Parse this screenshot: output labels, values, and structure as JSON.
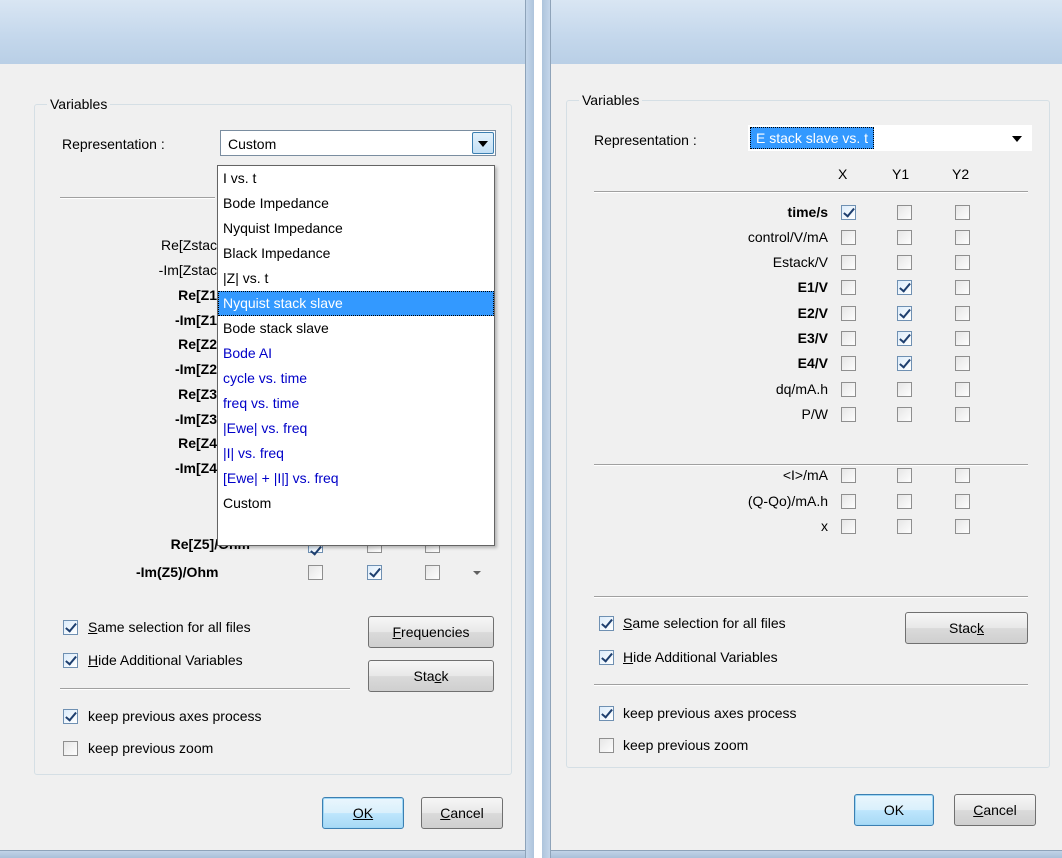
{
  "left_dialog": {
    "group_title": "Variables",
    "representation_label": "Representation :",
    "representation_value": "Custom",
    "dropdown_items": [
      {
        "label": "I vs. t",
        "style": "black"
      },
      {
        "label": "Bode Impedance",
        "style": "black"
      },
      {
        "label": "Nyquist Impedance",
        "style": "black"
      },
      {
        "label": "Black Impedance",
        "style": "black"
      },
      {
        "label": "|Z| vs. t",
        "style": "black"
      },
      {
        "label": "Nyquist stack slave",
        "style": "highlighted"
      },
      {
        "label": "Bode stack slave",
        "style": "black"
      },
      {
        "label": "Bode AI",
        "style": "blue"
      },
      {
        "label": "cycle vs. time",
        "style": "blue"
      },
      {
        "label": "freq vs. time",
        "style": "blue"
      },
      {
        "label": "|Ewe| vs. freq",
        "style": "blue"
      },
      {
        "label": "|I| vs. freq",
        "style": "blue"
      },
      {
        "label": "[Ewe| + |I|] vs. freq",
        "style": "blue"
      },
      {
        "label": "Custom",
        "style": "black"
      }
    ],
    "variables_visible": [
      {
        "text": "Re[Zstac",
        "bold": false
      },
      {
        "text": "-Im[Zstac",
        "bold": false
      },
      {
        "text": "Re[Z1",
        "bold": true
      },
      {
        "text": "-Im[Z1",
        "bold": true
      },
      {
        "text": "Re[Z2",
        "bold": true
      },
      {
        "text": "-Im[Z2",
        "bold": true
      },
      {
        "text": "Re[Z3",
        "bold": true
      },
      {
        "text": "-Im[Z3",
        "bold": true
      },
      {
        "text": "Re[Z4",
        "bold": true
      },
      {
        "text": "-Im[Z4",
        "bold": true
      },
      {
        "text": "Re[Z5]/Ohm",
        "bold": true
      }
    ],
    "last_row": {
      "label": "-Im(Z5)/Ohm",
      "x": false,
      "y1": true,
      "y2": false
    },
    "same_selection_label": "Same selection for all files",
    "same_selection_checked": true,
    "hide_additional_label": "Hide Additional Variables",
    "hide_additional_checked": true,
    "frequencies_label": "Frequencies",
    "stack_label": "Stack",
    "keep_axes_label": "keep previous axes process",
    "keep_axes_checked": true,
    "keep_zoom_label": "keep previous zoom",
    "keep_zoom_checked": false,
    "ok_label": "OK",
    "cancel_label": "Cancel"
  },
  "right_dialog": {
    "group_title": "Variables",
    "representation_label": "Representation :",
    "representation_value": "E stack slave vs. t",
    "col_x": "X",
    "col_y1": "Y1",
    "col_y2": "Y2",
    "rows": [
      {
        "label": "time/s",
        "bold": true,
        "x": true,
        "y1": false,
        "y2": false
      },
      {
        "label": "control/V/mA",
        "bold": false,
        "x": false,
        "y1": false,
        "y2": false
      },
      {
        "label": "Estack/V",
        "bold": false,
        "x": false,
        "y1": false,
        "y2": false
      },
      {
        "label": "E1/V",
        "bold": true,
        "x": false,
        "y1": true,
        "y2": false
      },
      {
        "label": "E2/V",
        "bold": true,
        "x": false,
        "y1": true,
        "y2": false
      },
      {
        "label": "E3/V",
        "bold": true,
        "x": false,
        "y1": true,
        "y2": false
      },
      {
        "label": "E4/V",
        "bold": true,
        "x": false,
        "y1": true,
        "y2": false
      },
      {
        "label": "dq/mA.h",
        "bold": false,
        "x": false,
        "y1": false,
        "y2": false
      },
      {
        "label": "P/W",
        "bold": false,
        "x": false,
        "y1": false,
        "y2": false
      },
      {
        "label": "<I>/mA",
        "bold": false,
        "x": false,
        "y1": false,
        "y2": false
      },
      {
        "label": "(Q-Qo)/mA.h",
        "bold": false,
        "x": false,
        "y1": false,
        "y2": false
      },
      {
        "label": "x",
        "bold": false,
        "x": false,
        "y1": false,
        "y2": false
      }
    ],
    "same_selection_label": "Same selection for all files",
    "same_selection_checked": true,
    "hide_additional_label": "Hide Additional Variables",
    "hide_additional_checked": true,
    "stack_label": "Stack",
    "keep_axes_label": "keep previous axes process",
    "keep_axes_checked": true,
    "keep_zoom_label": "keep previous zoom",
    "keep_zoom_checked": false,
    "ok_label": "OK",
    "cancel_label": "Cancel"
  }
}
